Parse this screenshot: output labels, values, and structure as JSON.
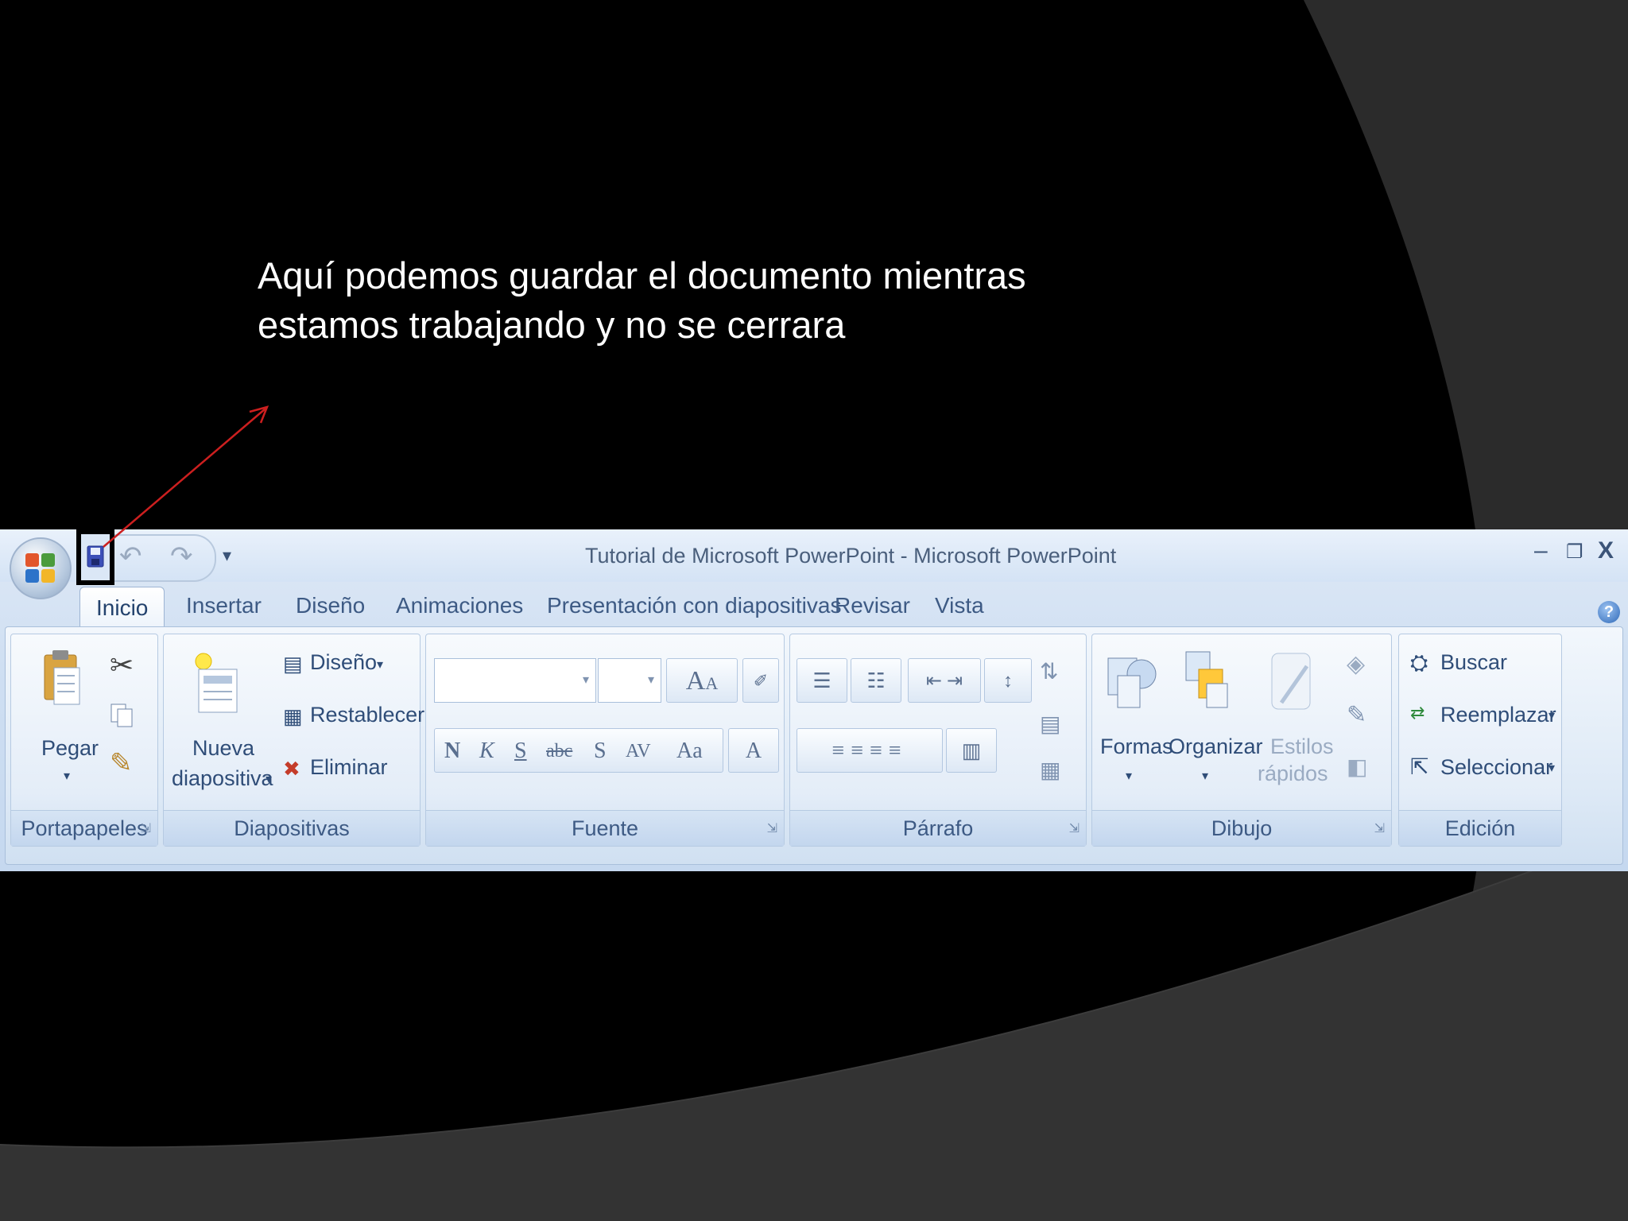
{
  "slide": {
    "caption_line1": "Aquí podemos guardar el documento mientras",
    "caption_line2": "estamos trabajando y no se cerrara",
    "background": "#000000",
    "arc_color": "#2a2a2a",
    "arrow_color": "#cc1f1f"
  },
  "app": {
    "window_title": "Tutorial de Microsoft PowerPoint - Microsoft PowerPoint",
    "minimize_glyph": "–",
    "restore_glyph": "❐",
    "close_glyph": "X",
    "help_glyph": "?",
    "undo_glyph": "↶",
    "redo_glyph": "↷",
    "customize_glyph": "▾"
  },
  "tabs": [
    "Inicio",
    "Insertar",
    "Diseño",
    "Animaciones",
    "Presentación con diapositivas",
    "Revisar",
    "Vista"
  ],
  "groups": {
    "portapapeles": {
      "label": "Portapapeles",
      "paste": "Pegar"
    },
    "diapositivas": {
      "label": "Diapositivas",
      "new_slide_line1": "Nueva",
      "new_slide_line2": "diapositiva",
      "layout": "Diseño",
      "reset": "Restablecer",
      "delete": "Eliminar"
    },
    "fuente": {
      "label": "Fuente",
      "bold": "N",
      "italic": "K",
      "underline": "S",
      "strike": "abc",
      "shadow": "S",
      "spacing": "AV",
      "case": "Aa",
      "color": "A",
      "grow": "A",
      "shrink": "A"
    },
    "parrafo": {
      "label": "Párrafo"
    },
    "dibujo": {
      "label": "Dibujo",
      "shapes": "Formas",
      "arrange": "Organizar",
      "styles_line1": "Estilos",
      "styles_line2": "rápidos"
    },
    "edicion": {
      "label": "Edición",
      "find": "Buscar",
      "replace": "Reemplazar",
      "select": "Seleccionar"
    }
  }
}
